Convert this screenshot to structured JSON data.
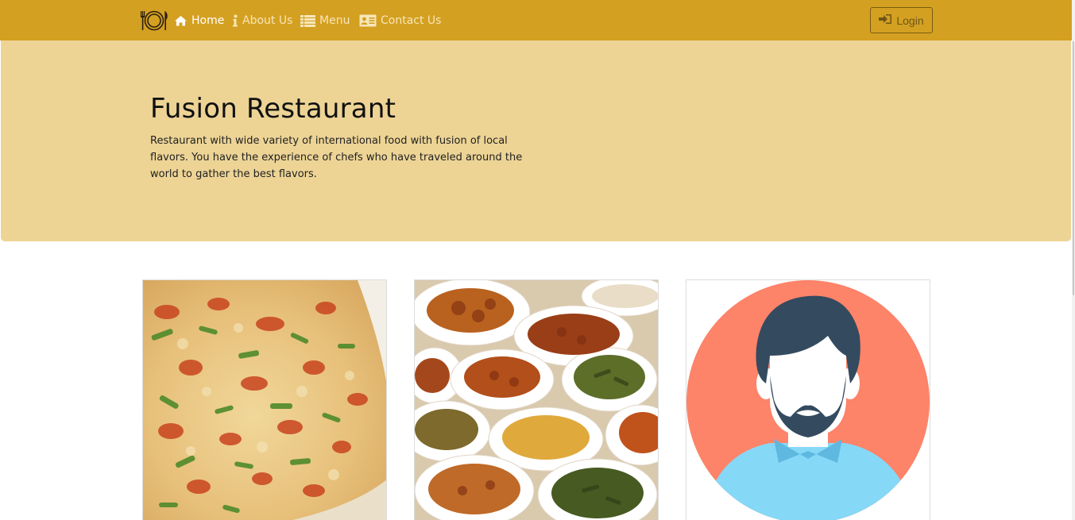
{
  "navbar": {
    "brand_icon": "plate-fork-knife-icon",
    "items": [
      {
        "label": "Home",
        "icon": "home-icon",
        "active": true
      },
      {
        "label": "About Us",
        "icon": "info-icon",
        "active": false
      },
      {
        "label": "Menu",
        "icon": "list-icon",
        "active": false
      },
      {
        "label": "Contact Us",
        "icon": "contact-card-icon",
        "active": false
      }
    ],
    "login_label": "Login",
    "login_icon": "sign-in-icon",
    "colors": {
      "background": "#d4a021",
      "active_text": "#ffffff",
      "text": "#f6e6b8"
    }
  },
  "hero": {
    "title": "Fusion Restaurant",
    "description": "Restaurant with wide variety of international food with fusion of local flavors. You have the experience of chefs who have traveled around the world to gather the best flavors.",
    "background": "#edd495"
  },
  "cards": [
    {
      "image": "pizza-image"
    },
    {
      "image": "indian-dishes-image"
    },
    {
      "image": "chef-avatar-image"
    }
  ]
}
